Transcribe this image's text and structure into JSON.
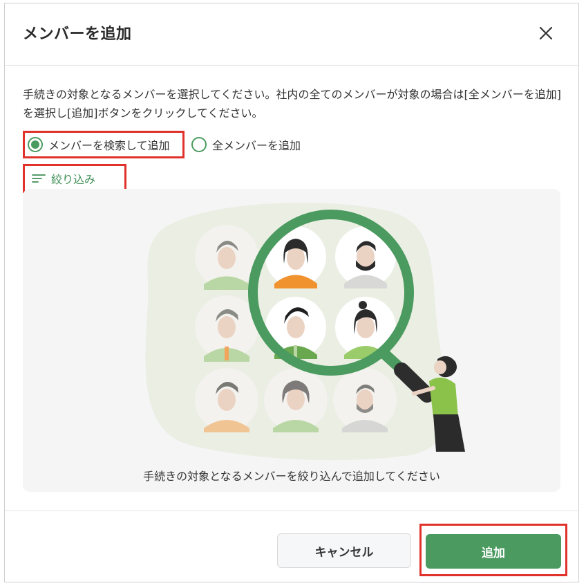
{
  "dialog": {
    "title": "メンバーを追加",
    "description": "手続きの対象となるメンバーを選択してください。社内の全てのメンバーが対象の場合は[全メンバーを追加]を選択し[追加]ボタンをクリックしてください。",
    "radio_options": [
      {
        "label": "メンバーを検索して追加",
        "selected": true
      },
      {
        "label": "全メンバーを追加",
        "selected": false
      }
    ],
    "filter_label": "絞り込み",
    "illustration_caption": "手続きの対象となるメンバーを絞り込んで追加してください",
    "cancel_label": "キャンセル",
    "add_label": "追加",
    "icons": {
      "close": "close-icon",
      "filter": "filter-lines-icon"
    },
    "colors": {
      "accent": "#4b9a5f",
      "highlight_box": "#e0312b"
    }
  }
}
